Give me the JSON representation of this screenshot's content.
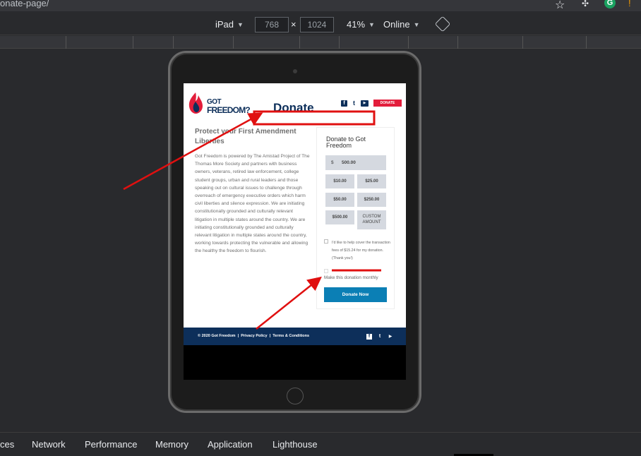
{
  "browser": {
    "url_fragment": "onate-page/",
    "star_icon": "star-icon",
    "extensions": [
      "extension-puzzle-icon",
      "grammarly-icon",
      "extension-warning-icon"
    ],
    "grammarly_letter": "G",
    "warning_letter": "!"
  },
  "device_toolbar": {
    "device": "iPad",
    "width": "768",
    "height": "1024",
    "times": "×",
    "zoom": "41%",
    "network": "Online",
    "rotate_icon": "rotate-icon"
  },
  "site": {
    "logo_line1": "GOT",
    "logo_line2": "FREEDOM?",
    "page_title": "Donate",
    "header_social": [
      "facebook-icon",
      "twitter-icon",
      "youtube-icon"
    ],
    "header_social_glyphs": [
      "f",
      "t",
      "▶"
    ],
    "header_donate": "DONATE",
    "heading": "Protect your First Amendment Liberties",
    "paragraph": "Got Freedom is powered by The Amistad Project of The Thomas More Society and partners with business owners, veterans, retired law enforcement, college student groups, urban and rural leaders and those speaking out on cultural issues to challenge through overreach of emergency executive orders which harm civil liberties and silence expression. We are initiating constitutionally grounded and culturally relevant litigation in multiple states around the country. We are initiating constitutionally grounded and culturally relevant litigation in multiple states around the country, working towards protecting the vulnerable and allowing the healthy the freedom to flourish.",
    "card": {
      "title": "Donate to Got Freedom",
      "currency": "$",
      "amount_value": "500.00",
      "options": [
        "$10.00",
        "$25.00",
        "$50.00",
        "$250.00",
        "$500.00"
      ],
      "custom_line1": "CUSTOM",
      "custom_line2": "AMOUNT",
      "fee_text": "I'd like to help cover the transaction fees of $15.24 for my donation. (Thank you!)",
      "monthly_text": "Make this donation monthly",
      "submit": "Donate Now"
    },
    "footer": {
      "copyright": "© 2020 Got Freedom",
      "sep": "|",
      "privacy": "Privacy Policy",
      "terms": "Terms & Conditions",
      "social_glyphs": [
        "f",
        "t",
        "▶"
      ]
    }
  },
  "devtools_tabs": [
    "ces",
    "Network",
    "Performance",
    "Memory",
    "Application",
    "Lighthouse"
  ],
  "colors": {
    "navy": "#0d2f5a",
    "red": "#e31d3b",
    "button_blue": "#0b7fb5",
    "annotation_red": "#e01010"
  }
}
